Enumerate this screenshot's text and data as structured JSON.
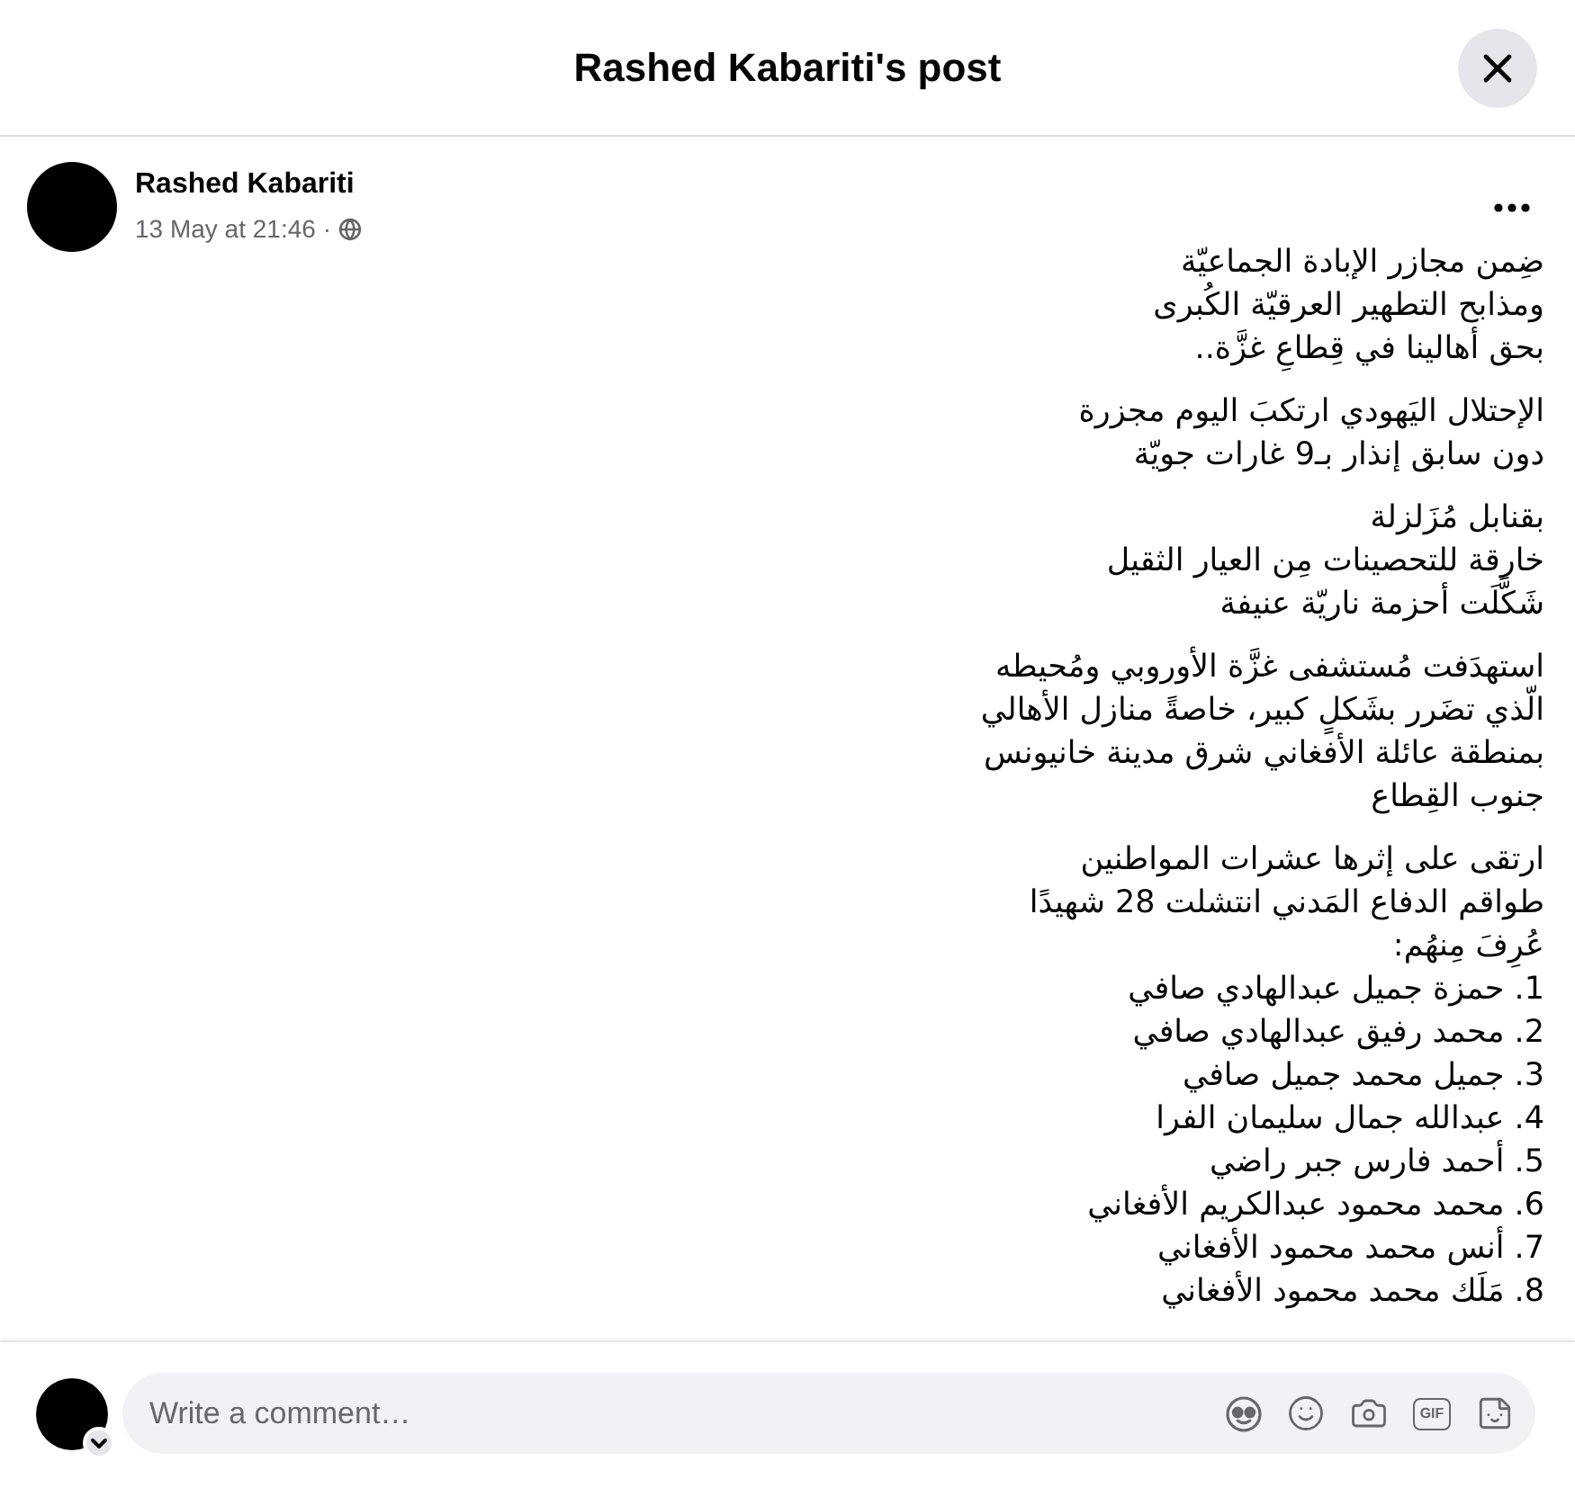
{
  "dialog": {
    "title": "Rashed Kabariti's post"
  },
  "post": {
    "author": "Rashed Kabariti",
    "timestamp": "13 May at 21:46",
    "separator": "·",
    "paragraphs": [
      [
        "ضِمن مجازر الإبادة الجماعيّة",
        "ومذابح التطهير العرقيّة الكُبرى",
        "بحق أهالينا في قِطاعِ غزَّة.."
      ],
      [
        "الإحتلال اليَهودي ارتكبَ اليوم مجزرة",
        "دون سابق إنذار بـ9 غارات جويّة"
      ],
      [
        "بقنابل مُزَلزلة",
        "خارقة للتحصينات مِن العيار الثقيل",
        "شَكَّلَت أحزمة ناريّة عنيفة"
      ],
      [
        "استهدَفت مُستشفى غزَّة الأوروبي ومُحيطه",
        "الّذي تضَرر بشَكلٍ كبير، خاصةً منازل الأهالي",
        "بمنطقة عائلة الأفغاني شرق مدينة خانيونس",
        "جنوب القِطاع"
      ],
      [
        "ارتقى على إثرها عشرات المواطنين",
        "طواقم الدفاع المَدني انتشلت 28 شهيدًا",
        "عُرِفَ مِنهُم:"
      ]
    ],
    "list_items": [
      "1. حمزة جميل عبدالهادي صافي",
      "2. محمد رفيق عبدالهادي صافي",
      "3. جميل محمد جميل صافي",
      "4. عبدالله جمال سليمان الفرا",
      "5. أحمد فارس جبر راضي",
      "6. محمد محمود عبدالكريم الأفغاني",
      "7. أنس محمد محمود الأفغاني",
      "8. مَلَك محمد محمود الأفغاني"
    ]
  },
  "comment_box": {
    "placeholder": "Write a comment…",
    "gif_label": "GIF"
  }
}
